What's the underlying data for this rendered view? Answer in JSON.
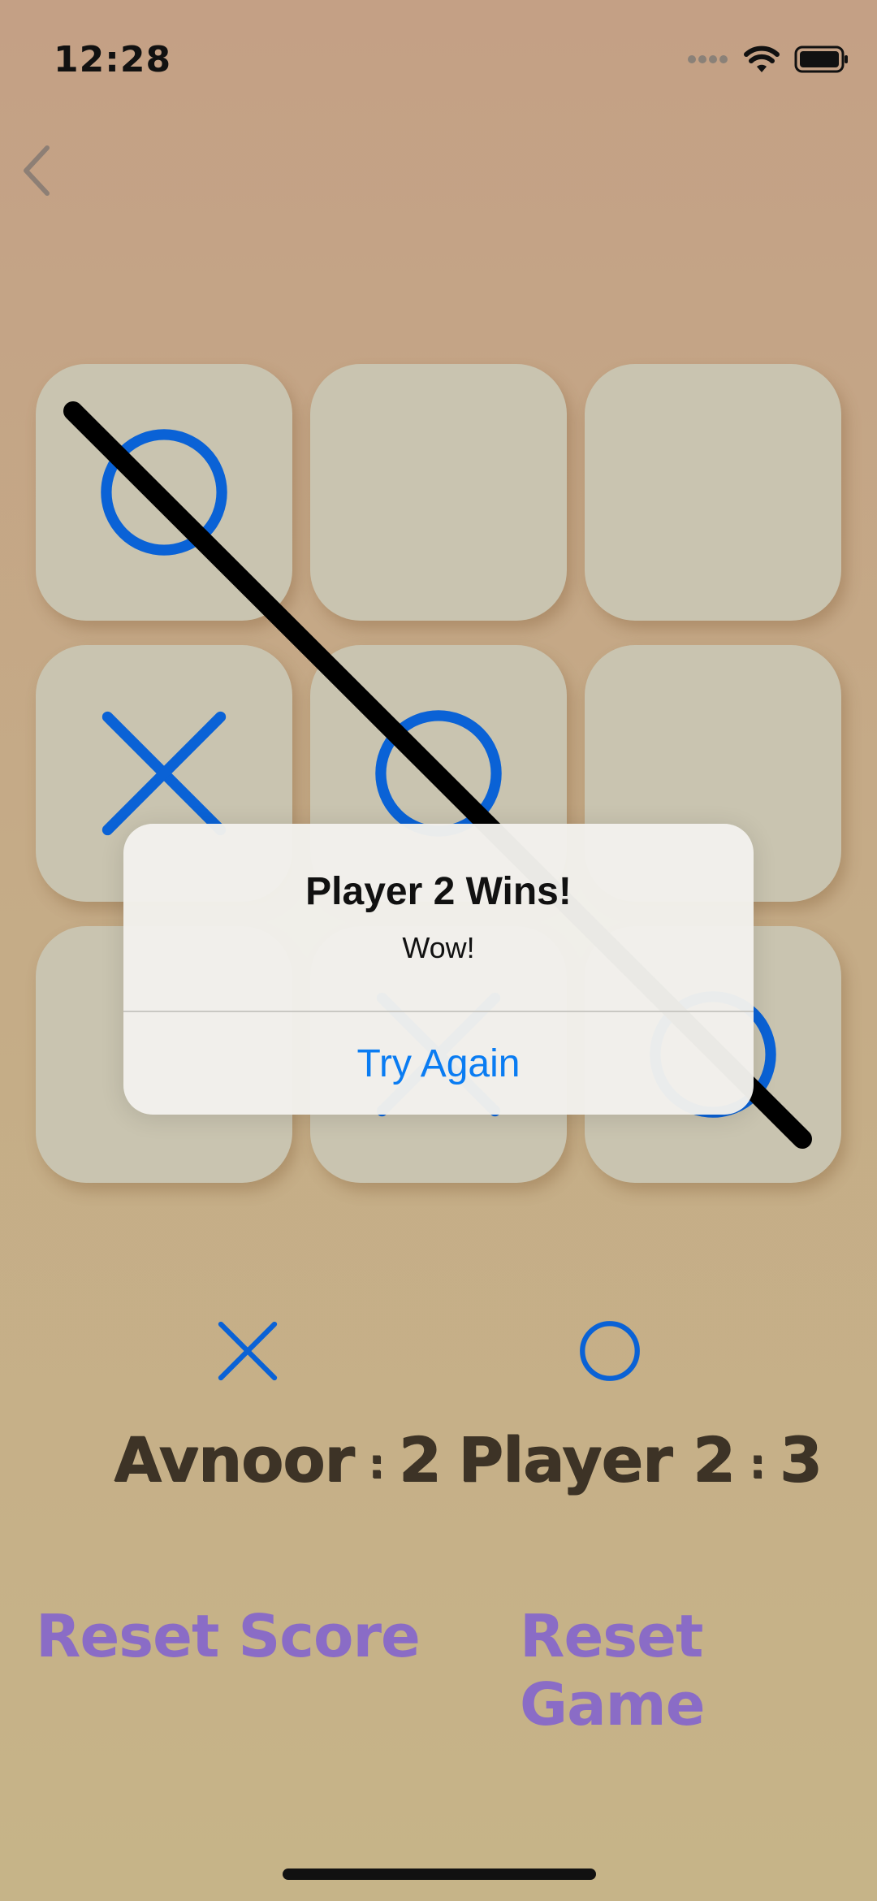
{
  "status_bar": {
    "time": "12:28"
  },
  "board": {
    "cells": [
      "O",
      "",
      "",
      "X",
      "O",
      "",
      "",
      "X",
      "O"
    ]
  },
  "alert": {
    "title": "Player 2 Wins!",
    "message": "Wow!",
    "action_label": "Try Again"
  },
  "players": [
    {
      "name": "Avnoor",
      "symbol": "X",
      "score": "2"
    },
    {
      "name": "Player 2",
      "symbol": "O",
      "score": "3"
    }
  ],
  "score_separator": ":",
  "buttons": {
    "reset_score": "Reset Score",
    "reset_game": "Reset Game"
  },
  "colors": {
    "mark": "#0a62d6",
    "strike": "#000000",
    "alert_action": "#0a7cf2",
    "link": "#8a6cc6"
  },
  "icons": {
    "back": "chevron-left-icon",
    "signal": "cellular-signal-icon",
    "wifi": "wifi-icon",
    "battery": "battery-icon"
  }
}
